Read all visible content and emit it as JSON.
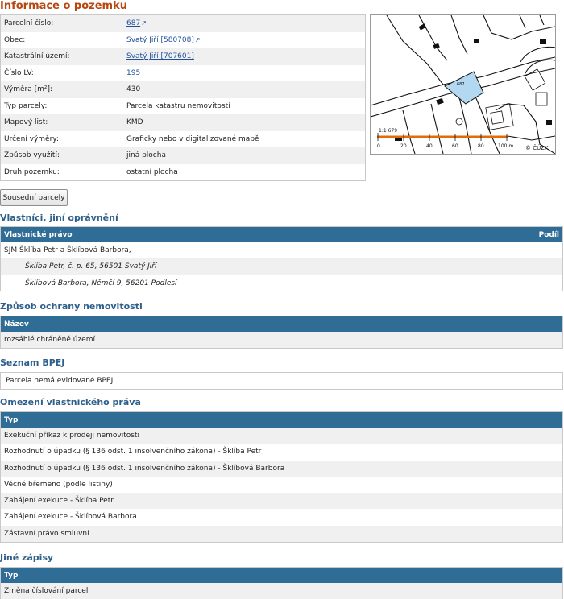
{
  "page_title": "Informace o pozemku",
  "info_rows": [
    {
      "label": "Parcelní číslo:",
      "value": "687",
      "link": true
    },
    {
      "label": "Obec:",
      "value": "Svatý Jiří [580708]",
      "link": true
    },
    {
      "label": "Katastrální území:",
      "value": "Svatý Jiří [707601]",
      "link": true,
      "no_ext": true
    },
    {
      "label": "Číslo LV:",
      "value": "195",
      "link": true,
      "no_ext": true
    },
    {
      "label": "Výměra [m²]:",
      "value": "430",
      "link": false
    },
    {
      "label": "Typ parcely:",
      "value": "Parcela katastru nemovitostí",
      "link": false
    },
    {
      "label": "Mapový list:",
      "value": "KMD",
      "link": false
    },
    {
      "label": "Určení výměry:",
      "value": "Graficky nebo v digitalizované mapě",
      "link": false
    },
    {
      "label": "Způsob využití:",
      "value": "jiná plocha",
      "link": false
    },
    {
      "label": "Druh pozemku:",
      "value": "ostatní plocha",
      "link": false
    }
  ],
  "map": {
    "scale_ratio": "1:1 679",
    "scale_ticks": [
      "0",
      "20",
      "40",
      "60",
      "80",
      "100 m"
    ],
    "parcel_number": "687",
    "copyright": "© ČÚZK",
    "scale_color": "#e36c09",
    "parcel_color": "#b3d9f2"
  },
  "neighbor_button": "Sousední parcely",
  "owners": {
    "title": "Vlastníci, jiní oprávnění",
    "col_left": "Vlastnické právo",
    "col_right": "Podíl",
    "rows": [
      "SJM Šklíba Petr a Šklíbová Barbora,",
      "Šklíba Petr, č. p. 65, 56501 Svatý Jiří",
      "Šklíbová Barbora, Němčí 9, 56201 Podlesí"
    ]
  },
  "protection": {
    "title": "Způsob ochrany nemovitosti",
    "col": "Název",
    "rows": [
      "rozsáhlé chráněné území"
    ]
  },
  "bpej": {
    "title": "Seznam BPEJ",
    "note": "Parcela nemá evidované BPEJ."
  },
  "restrictions": {
    "title": "Omezení vlastnického práva",
    "col": "Typ",
    "rows": [
      "Exekuční příkaz k prodeji nemovitosti",
      "Rozhodnutí o úpadku (§ 136 odst. 1 insolvenčního zákona) - Šklíba Petr",
      "Rozhodnutí o úpadku (§ 136 odst. 1 insolvenčního zákona) - Šklíbová Barbora",
      "Věcné břemeno (podle listiny)",
      "Zahájení exekuce - Šklíba Petr",
      "Zahájení exekuce - Šklíbová Barbora",
      "Zástavní právo smluvní"
    ]
  },
  "other": {
    "title": "Jiné zápisy",
    "col": "Typ",
    "rows": [
      "Změna číslování parcel"
    ]
  }
}
